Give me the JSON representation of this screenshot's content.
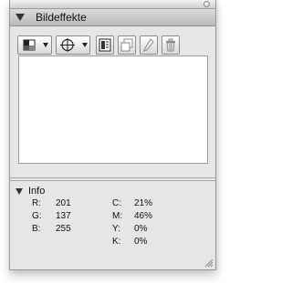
{
  "panel": {
    "title": "Bildeffekte"
  },
  "toolbar": {
    "buttons": [
      {
        "icon": "grid-blocks-icon",
        "has_dropdown": true
      },
      {
        "icon": "crosshair-icon",
        "has_dropdown": true
      },
      {
        "icon": "layer-panel-icon",
        "has_dropdown": false
      },
      {
        "icon": "duplicate-icon",
        "has_dropdown": false
      },
      {
        "icon": "pencil-icon",
        "has_dropdown": false
      },
      {
        "icon": "trash-icon",
        "has_dropdown": false
      }
    ]
  },
  "info": {
    "title": "Info",
    "rgb": [
      {
        "label": "R:",
        "value": "201"
      },
      {
        "label": "G:",
        "value": "137"
      },
      {
        "label": "B:",
        "value": "255"
      }
    ],
    "cmyk": [
      {
        "label": "C:",
        "value": "21%"
      },
      {
        "label": "M:",
        "value": "46%"
      },
      {
        "label": "Y:",
        "value": "0%"
      },
      {
        "label": "K:",
        "value": "0%"
      }
    ]
  }
}
